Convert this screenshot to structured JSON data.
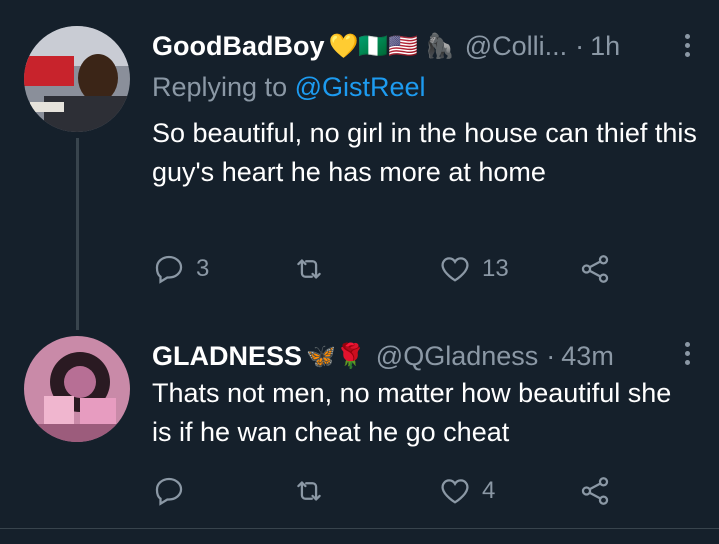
{
  "tweets": [
    {
      "name": "GoodBadBoy",
      "name_emojis": "💛🇳🇬🇺🇸 🦍",
      "handle": "@Colli...",
      "dot": "·",
      "time": "1h",
      "replying_prefix": "Replying to",
      "replying_to": "@GistReel",
      "text": "So beautiful, no girl in the house can thief this guy's heart he has more at home",
      "reply_count": "3",
      "retweet_count": "",
      "like_count": "13",
      "avatar_icon": "avatar-photo"
    },
    {
      "name": "GLADNESS",
      "name_emojis": "🦋🌹",
      "handle": "@QGladness",
      "dot": "·",
      "time": "43m",
      "text": "Thats not men, no matter how beautiful she is if he wan cheat he go cheat",
      "reply_count": "",
      "retweet_count": "",
      "like_count": "4",
      "avatar_icon": "avatar-photo"
    }
  ],
  "colors": {
    "background": "#15202b",
    "text": "#ffffff",
    "muted": "#8b98a5",
    "link": "#1d9bf0",
    "line": "#38444d"
  }
}
